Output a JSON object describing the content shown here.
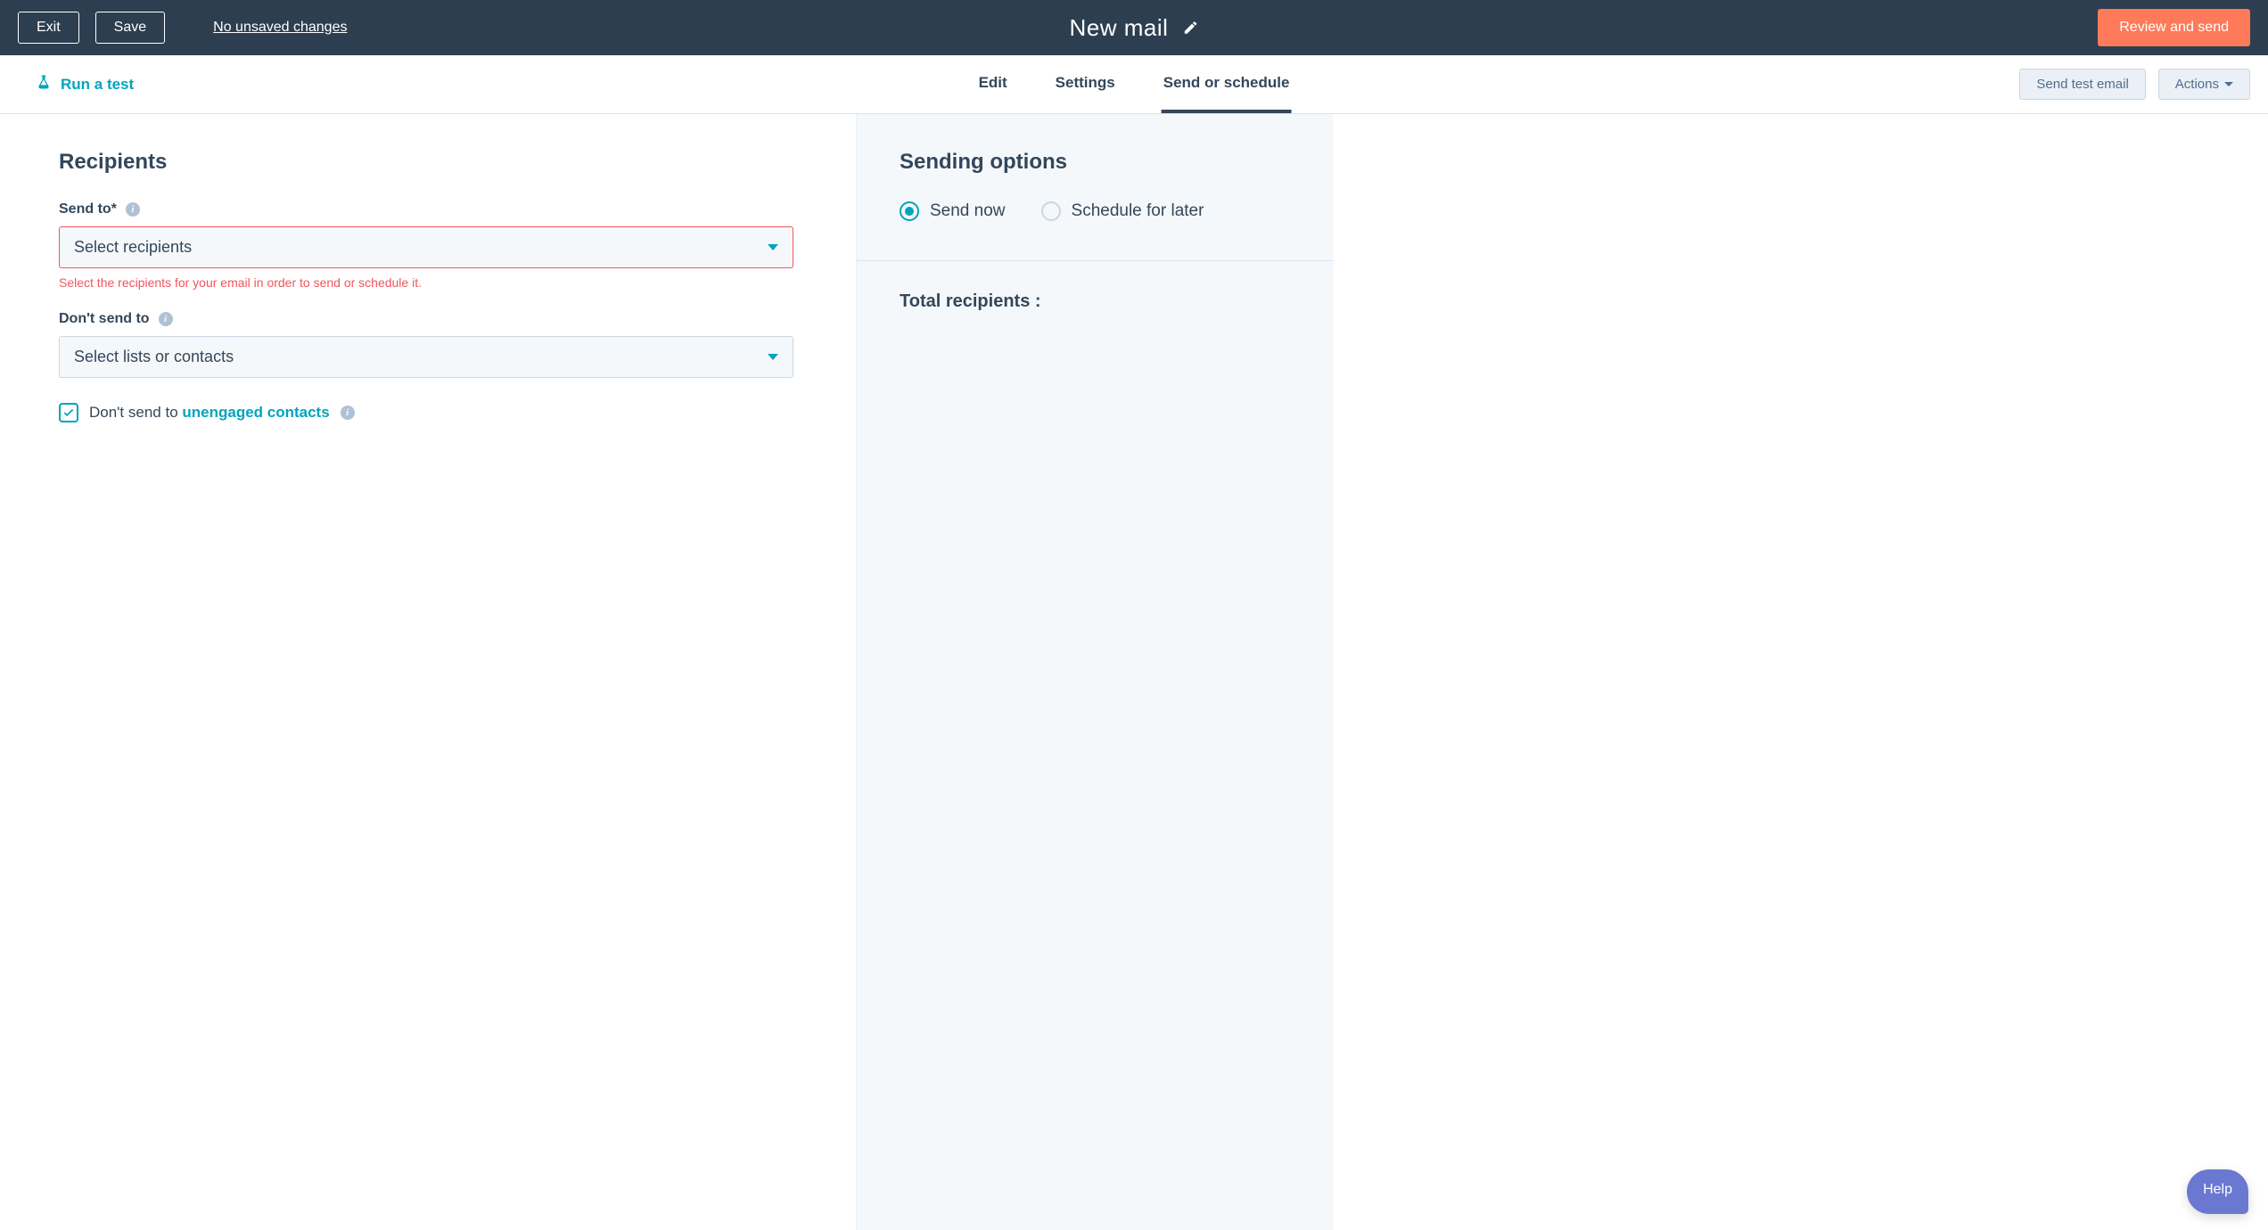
{
  "topbar": {
    "exit": "Exit",
    "save": "Save",
    "unsaved": "No unsaved changes",
    "title": "New mail",
    "review": "Review and send"
  },
  "secondbar": {
    "run_test": "Run a test",
    "tabs": {
      "edit": "Edit",
      "settings": "Settings",
      "send": "Send or schedule"
    },
    "send_test": "Send test email",
    "actions": "Actions"
  },
  "recipients": {
    "heading": "Recipients",
    "send_to_label": "Send to*",
    "send_to_placeholder": "Select recipients",
    "send_to_error": "Select the recipients for your email in order to send or schedule it.",
    "dont_send_label": "Don't send to",
    "dont_send_placeholder": "Select lists or contacts",
    "checkbox_prefix": "Don't send to ",
    "checkbox_link": "unengaged contacts"
  },
  "sending": {
    "heading": "Sending options",
    "now": "Send now",
    "later": "Schedule for later",
    "total": "Total recipients :"
  },
  "help": "Help",
  "info_glyph": "i"
}
